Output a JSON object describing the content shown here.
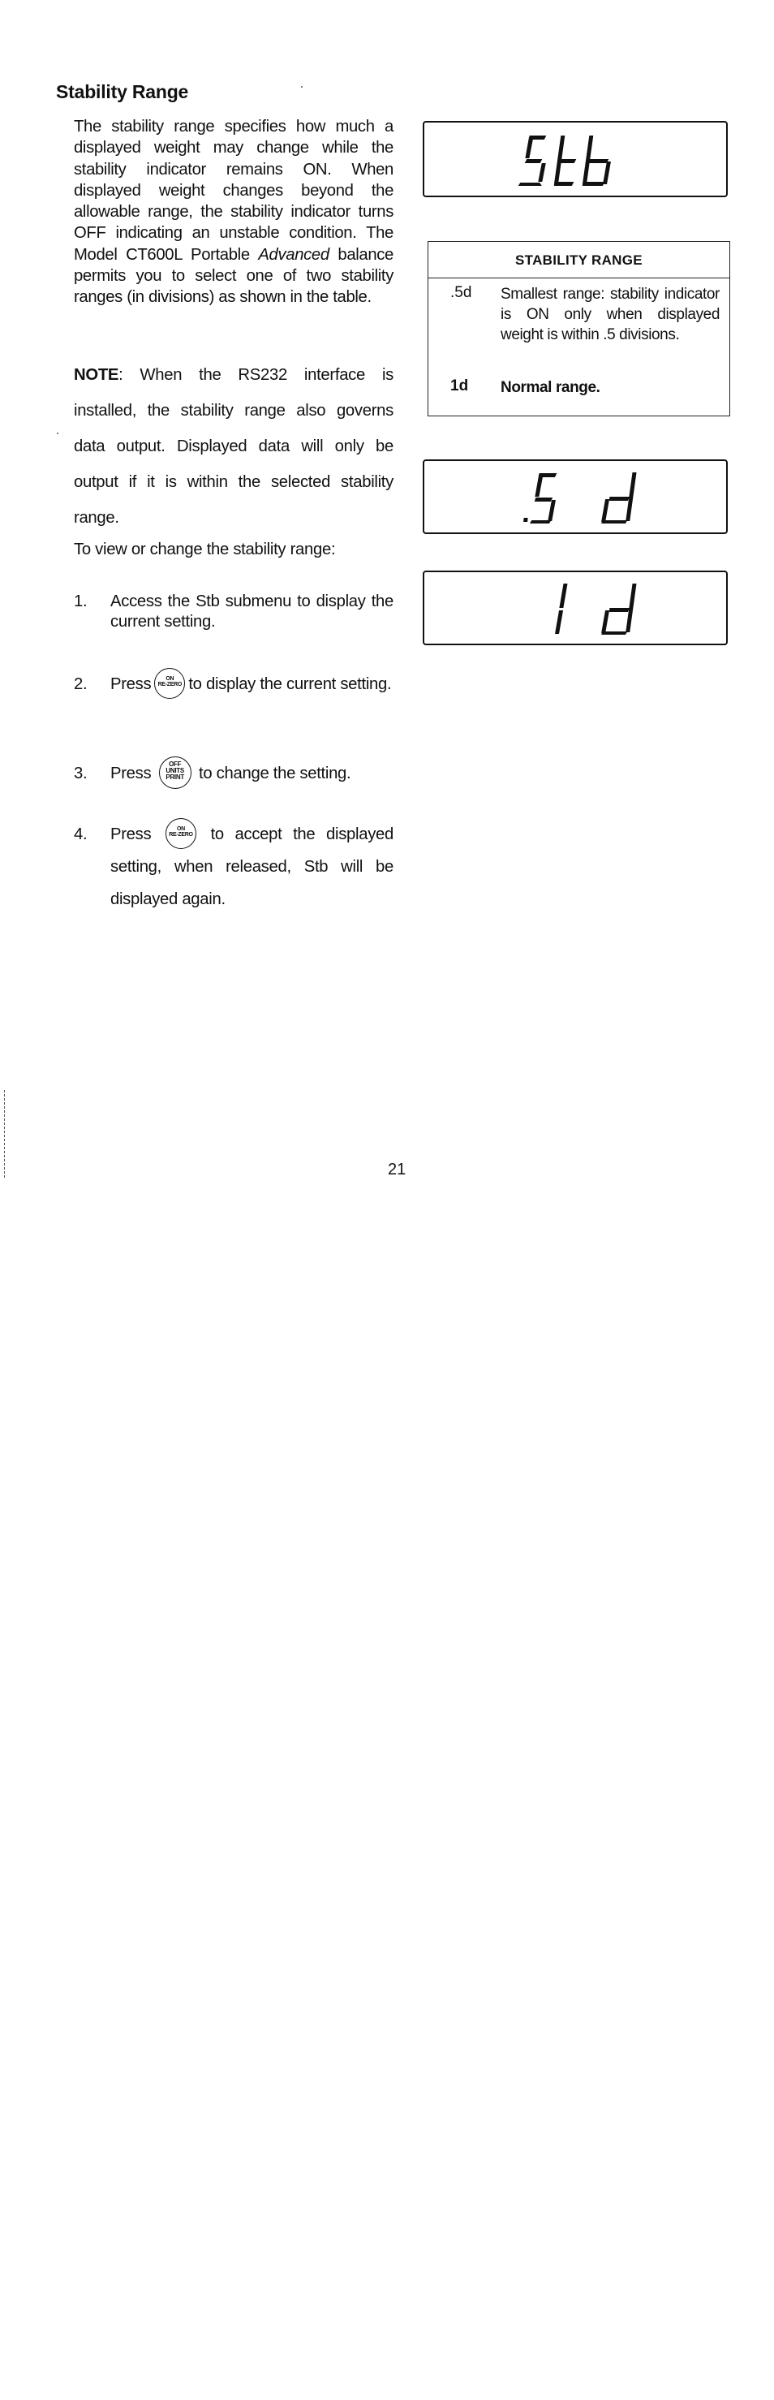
{
  "heading": "Stability Range",
  "paragraph": {
    "before_italic": "The stability range specifies how much a displayed weight may change while the stability indicator remains ON. When displayed weight changes beyond the allowable range, the stability indicator turns OFF indicating an unstable condition. The Model CT600L Portable ",
    "italic": "Advanced",
    "after_italic": " balance permits you to select one of two stability ranges (in divisions) as shown in the table."
  },
  "note": {
    "label": "NOTE",
    "text": ":  When the RS232 interface is installed, the stability range also governs data output. Displayed data will only be output if it is within the selected stability range."
  },
  "intro": "To view or change the stability range:",
  "steps": [
    {
      "num": "1.",
      "text": "Access the Stb submenu to display the current setting."
    },
    {
      "num": "2.",
      "before": "Press",
      "button": "on-rezero",
      "after": "to display the current setting."
    },
    {
      "num": "3.",
      "before": "Press",
      "button": "off-units-print",
      "after": "to change the setting."
    },
    {
      "num": "4.",
      "before": "Press",
      "button": "on-rezero",
      "after": "to accept the displayed setting,  when released, Stb will be displayed again."
    }
  ],
  "buttons": {
    "on_rezero": {
      "line1": "ON",
      "line2": "RE-ZERO"
    },
    "off_units_print": {
      "line1": "OFF",
      "line2": "UNITS",
      "line3": "PRINT"
    }
  },
  "displays": {
    "stb": "Stb",
    "half_d": ".5 d",
    "one_d": "1 d"
  },
  "table": {
    "title": "STABILITY RANGE",
    "rows": [
      {
        "key": ".5d",
        "desc": "Smallest range: stability indicator is ON only when displayed weight is within .5 divisions."
      },
      {
        "key": "1d",
        "desc": "Normal range."
      }
    ]
  },
  "page_number": "21"
}
